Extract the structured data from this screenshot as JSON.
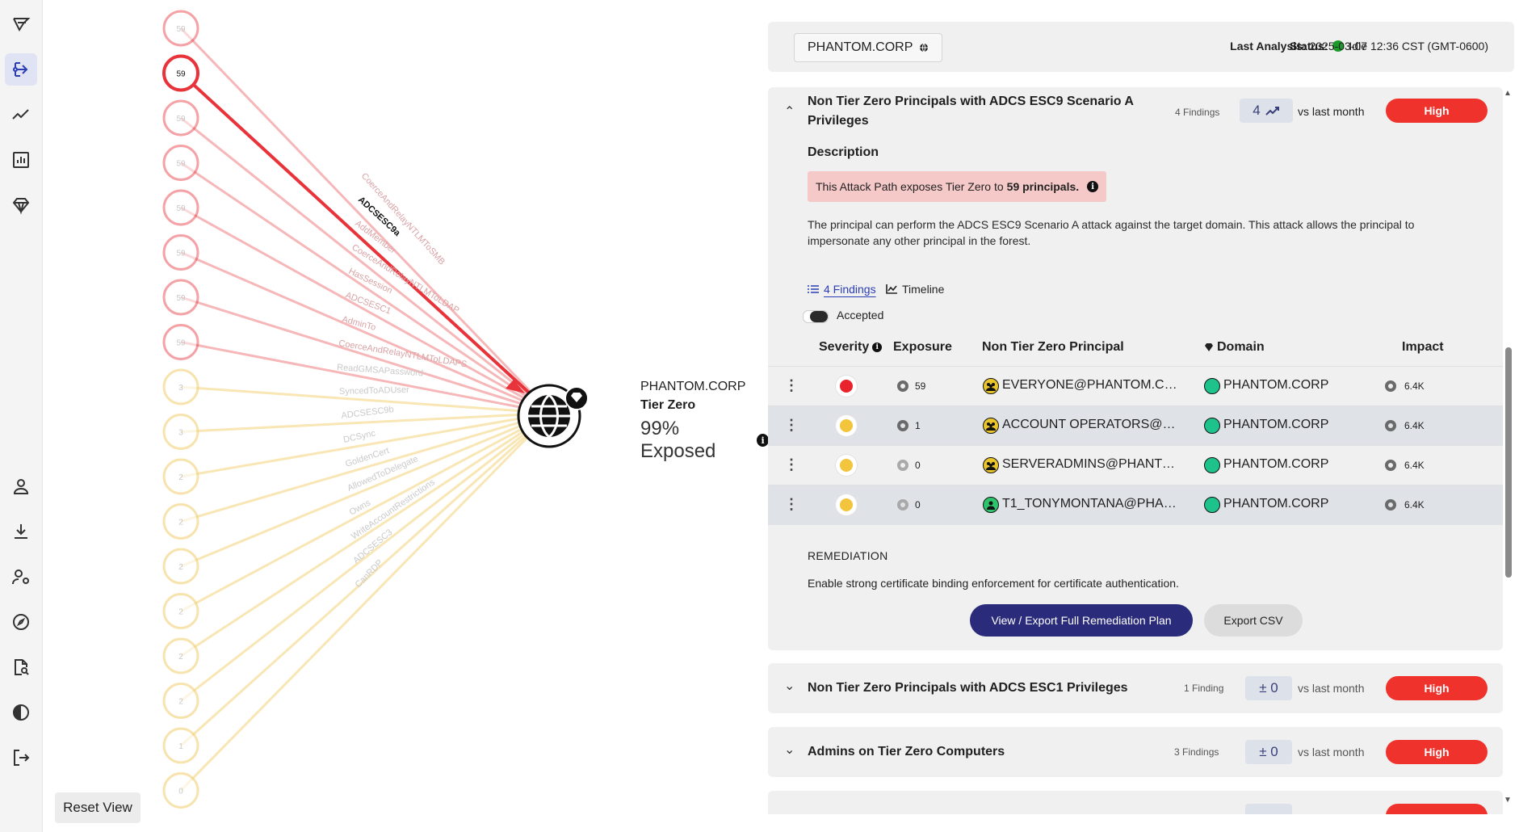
{
  "nav": {
    "items": [
      {
        "icon": "logo-icon"
      },
      {
        "icon": "attack-paths-icon"
      },
      {
        "icon": "trend-icon"
      },
      {
        "icon": "reports-icon"
      },
      {
        "icon": "tier-zero-icon"
      },
      {
        "icon": "user-icon"
      },
      {
        "icon": "download-icon"
      },
      {
        "icon": "user-settings-icon"
      },
      {
        "icon": "compass-icon"
      },
      {
        "icon": "search-doc-icon"
      },
      {
        "icon": "contrast-icon"
      },
      {
        "icon": "logout-icon"
      }
    ]
  },
  "graph": {
    "nodes": [
      {
        "label": "59",
        "kind": "red",
        "selected": false
      },
      {
        "label": "59",
        "kind": "red",
        "selected": true
      },
      {
        "label": "59",
        "kind": "red",
        "selected": false
      },
      {
        "label": "59",
        "kind": "red",
        "selected": false
      },
      {
        "label": "59",
        "kind": "red",
        "selected": false
      },
      {
        "label": "59",
        "kind": "red",
        "selected": false
      },
      {
        "label": "59",
        "kind": "red",
        "selected": false
      },
      {
        "label": "59",
        "kind": "red",
        "selected": false
      },
      {
        "label": "3",
        "kind": "yellow",
        "selected": false
      },
      {
        "label": "3",
        "kind": "yellow",
        "selected": false
      },
      {
        "label": "2",
        "kind": "yellow",
        "selected": false
      },
      {
        "label": "2",
        "kind": "yellow",
        "selected": false
      },
      {
        "label": "2",
        "kind": "yellow",
        "selected": false
      },
      {
        "label": "2",
        "kind": "yellow",
        "selected": false
      },
      {
        "label": "2",
        "kind": "yellow",
        "selected": false
      },
      {
        "label": "2",
        "kind": "yellow",
        "selected": false
      },
      {
        "label": "1",
        "kind": "yellow",
        "selected": false
      },
      {
        "label": "0",
        "kind": "yellow",
        "selected": false
      }
    ],
    "edge_labels": [
      "CoerceAndRelayNTLMToSMB",
      "ADCSESC9a",
      "AddMember",
      "CoerceAndRelayNTLMToLDAP",
      "HasSession",
      "ADCSESC1",
      "AdminTo",
      "CoerceAndRelayNTLMToLDAPS",
      "ReadGMSAPassword",
      "SyncedToADUser",
      "ADCSESC9b",
      "DCSync",
      "GoldenCert",
      "AllowedToDelegate",
      "Owns",
      "WriteAccountRestrictions",
      "ADCSESC3",
      "CanRDP"
    ],
    "target_domain": "PHANTOM.CORP",
    "target_tier": "Tier Zero",
    "target_exposed": "99% Exposed",
    "reset_label": "Reset View",
    "colors": {
      "red": "#e8333a",
      "yellow": "#f3d27a"
    }
  },
  "header": {
    "domain": "PHANTOM.CORP",
    "status_label": "Status:",
    "status_value": "Idle",
    "last_analysis_label": "Last Analysis:",
    "last_analysis_value": "2025-03-07 12:36 CST (GMT-0600)"
  },
  "finding1": {
    "title_line1": "Non Tier Zero Principals with ADCS ESC9 Scenario A",
    "title_line2": "Privileges",
    "findings_count": "4 Findings",
    "trend_value": "4",
    "vs_text": "vs last month",
    "severity": "High",
    "description_title": "Description",
    "exposure_prefix": "This Attack Path exposes Tier Zero to",
    "exposure_bold": "59 principals.",
    "description": "The principal can perform the ADCS ESC9 Scenario A attack against the target domain. This attack allows the principal to impersonate any other principal in the forest.",
    "tab_findings": "4 Findings",
    "tab_timeline": "Timeline",
    "accepted_label": "Accepted",
    "columns": {
      "severity": "Severity",
      "exposure": "Exposure",
      "principal": "Non Tier Zero Principal",
      "domain": "Domain",
      "impact": "Impact"
    },
    "rows": [
      {
        "severity_color": "#e8232b",
        "exposure": "59",
        "principal": "EVERYONE@PHANTOM.CORP",
        "principal_icon": "group-icon",
        "domain": "PHANTOM.CORP",
        "impact": "6.4K"
      },
      {
        "severity_color": "#f2c53d",
        "exposure": "1",
        "principal": "ACCOUNT OPERATORS@PHANTOM.CORP",
        "principal_icon": "group-icon",
        "domain": "PHANTOM.CORP",
        "impact": "6.4K"
      },
      {
        "severity_color": "#f2c53d",
        "exposure": "0",
        "principal": "SERVERADMINS@PHANTOM.CORP",
        "principal_icon": "group-icon",
        "domain": "PHANTOM.CORP",
        "impact": "6.4K"
      },
      {
        "severity_color": "#f2c53d",
        "exposure": "0",
        "principal": "T1_TONYMONTANA@PHANTOM.CORP",
        "principal_icon": "user-icon",
        "domain": "PHANTOM.CORP",
        "impact": "6.4K"
      }
    ],
    "remediation_title": "REMEDIATION",
    "remediation_text": "Enable strong certificate binding enforcement for certificate authentication.",
    "view_export_label": "View / Export Full Remediation Plan",
    "export_csv_label": "Export CSV"
  },
  "finding2": {
    "title": "Non Tier Zero Principals with ADCS ESC1 Privileges",
    "findings_count": "1 Finding",
    "trend_value": "± 0",
    "vs_text": "vs last month",
    "severity": "High"
  },
  "finding3": {
    "title": "Admins on Tier Zero Computers",
    "findings_count": "3 Findings",
    "trend_value": "± 0",
    "vs_text": "vs last month",
    "severity": "High"
  }
}
